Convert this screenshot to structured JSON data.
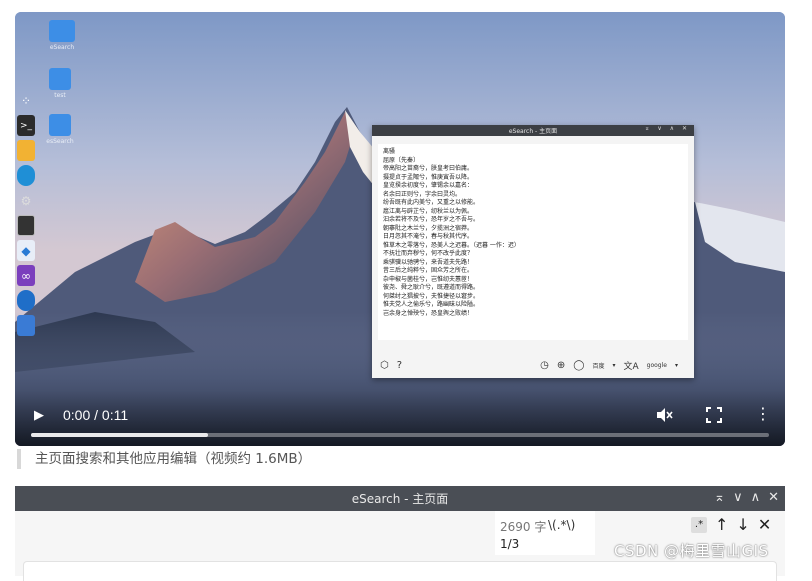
{
  "video": {
    "time_display": "0:00 / 0:11",
    "progress_fraction": 0.24,
    "controls": {
      "play_icon": "play-icon",
      "mute_icon": "volume-muted-icon",
      "fullscreen_icon": "fullscreen-icon",
      "more_icon": "more-vertical-icon"
    }
  },
  "desktop": {
    "icons": [
      {
        "label": "eSearch",
        "color": "#3d8ee6",
        "icon": "folder-icon"
      },
      {
        "label": "test",
        "color": "#3d8ee6",
        "icon": "app-icon"
      },
      {
        "label": "esSearch",
        "color": "#3d8ee6",
        "icon": "app-icon"
      }
    ],
    "dock": [
      "apps-icon",
      "terminal-icon",
      "files-icon",
      "edge-icon",
      "settings-icon",
      "monitor-icon",
      "vscode-icon",
      "visual-studio-icon",
      "search-icon",
      "camera-icon"
    ]
  },
  "inner_window": {
    "title": "eSearch - 主页面",
    "controls": "⌅ ∨ ∧ ✕",
    "lines": [
      "离骚",
      "屈原〔先秦〕",
      "帝高阳之苗裔兮，朕皇考曰伯庸。",
      "摄提贞于孟陬兮，惟庚寅吾以降。",
      "皇览揆余初度兮，肇锡余以嘉名：",
      "名余曰正则兮，字余曰灵均。",
      "纷吾既有此内美兮，又重之以修能。",
      "扈江离与辟芷兮，纫秋兰以为佩。",
      "汩余若将不及兮，恐年岁之不吾与。",
      "朝搴阰之木兰兮，夕揽洲之宿莽。",
      "日月忽其不淹兮，春与秋其代序。",
      "惟草木之零落兮，恐美人之迟暮。（迟暮 一作：迟）",
      "不抚壮而弃秽兮，何不改乎此度？",
      "乘骐骥以驰骋兮，来吾道夫先路！",
      "昔三后之纯粹兮，固众芳之所在。",
      "杂申椒与菌桂兮，岂惟纫夫蕙茝！",
      "彼尧、舜之耿介兮，既遵道而得路。",
      "何桀纣之猖披兮，夫惟捷径以窘步。",
      "惟夫党人之偷乐兮，路幽昧以险隘。",
      "岂余身之惮殃兮，恐皇舆之败绩！"
    ],
    "toolbar": {
      "left_icons": [
        "cube-icon",
        "help-icon"
      ],
      "history_icon": "history-icon",
      "web_icon": "globe-icon",
      "search_icon": "search-icon",
      "engine": "百度",
      "translate_icon": "translate-icon",
      "translate_engine": "google"
    }
  },
  "caption": "主页面搜索和其他应用编辑（视频约 1.6MB）",
  "window2": {
    "title": "eSearch - 主页面",
    "controls": [
      "⌅",
      "∨",
      "∧",
      "✕"
    ],
    "find": {
      "count": "2690 字",
      "query": "\\(.*\\)",
      "position": "1/3",
      "regex_toggle": ".*",
      "prev": "↑",
      "next": "↓",
      "close": "✕"
    }
  },
  "watermark": "CSDN @梅里雪山GIS"
}
